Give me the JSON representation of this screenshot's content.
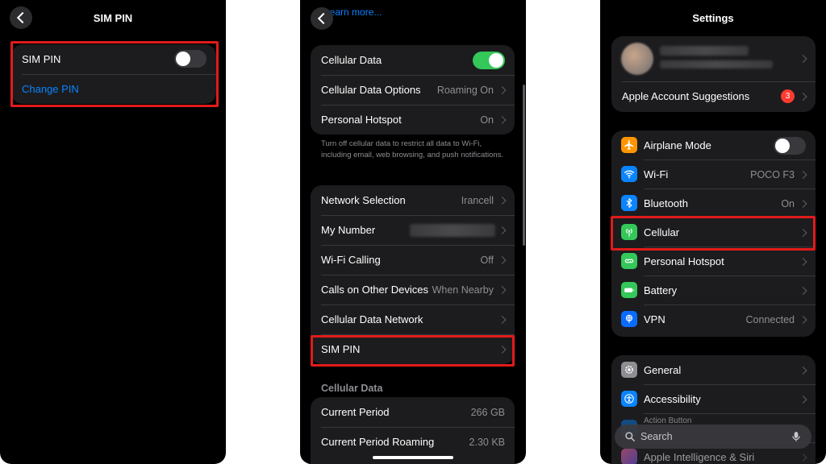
{
  "panel1": {
    "title": "SIM PIN",
    "sim_pin_label": "SIM PIN",
    "sim_pin_on": false,
    "change_pin_label": "Change PIN"
  },
  "panel2": {
    "top_link": "Learn more...",
    "group1": [
      {
        "label": "Cellular Data",
        "toggle": true
      },
      {
        "label": "Cellular Data Options",
        "value": "Roaming On"
      },
      {
        "label": "Personal Hotspot",
        "value": "On"
      }
    ],
    "footnote": "Turn off cellular data to restrict all data to Wi-Fi, including email, web browsing, and push notifications.",
    "group2": [
      {
        "label": "Network Selection",
        "value": "Irancell"
      },
      {
        "label": "My Number",
        "value": ""
      },
      {
        "label": "Wi-Fi Calling",
        "value": "Off"
      },
      {
        "label": "Calls on Other Devices",
        "value": "When Nearby"
      },
      {
        "label": "Cellular Data Network",
        "value": ""
      },
      {
        "label": "SIM PIN",
        "value": ""
      }
    ],
    "section_header": "Cellular Data",
    "group3": [
      {
        "label": "Current Period",
        "value": "266 GB"
      },
      {
        "label": "Current Period Roaming",
        "value": "2.30 KB"
      }
    ]
  },
  "panel3": {
    "title": "Settings",
    "account_suggestions_label": "Apple Account Suggestions",
    "account_suggestions_badge": "3",
    "group1": [
      {
        "label": "Airplane Mode",
        "icon": "airplane-icon",
        "color": "#ff9500",
        "toggle": false
      },
      {
        "label": "Wi-Fi",
        "icon": "wifi-icon",
        "color": "#0a84ff",
        "value": "POCO F3"
      },
      {
        "label": "Bluetooth",
        "icon": "bluetooth-icon",
        "color": "#0a84ff",
        "value": "On"
      },
      {
        "label": "Cellular",
        "icon": "antenna-icon",
        "color": "#34c759",
        "value": ""
      },
      {
        "label": "Personal Hotspot",
        "icon": "hotspot-icon",
        "color": "#34c759",
        "value": ""
      },
      {
        "label": "Battery",
        "icon": "battery-icon",
        "color": "#34c759",
        "value": ""
      },
      {
        "label": "VPN",
        "icon": "vpn-globe-icon",
        "color": "#0a6cff",
        "value": "Connected"
      }
    ],
    "group2": [
      {
        "label": "General",
        "icon": "gear-icon",
        "color": "#8e8e93"
      },
      {
        "label": "Accessibility",
        "icon": "accessibility-icon",
        "color": "#0a84ff"
      },
      {
        "label": "Action Button",
        "icon": "action-button-icon",
        "color": "#0a84ff"
      },
      {
        "label": "Apple Intelligence & Siri",
        "icon": "siri-icon",
        "color": "#7a5af8"
      }
    ],
    "search_placeholder": "Search"
  },
  "colors": {
    "highlight": "#e11b1b",
    "toggle_on": "#34c759",
    "link": "#0a84ff"
  }
}
